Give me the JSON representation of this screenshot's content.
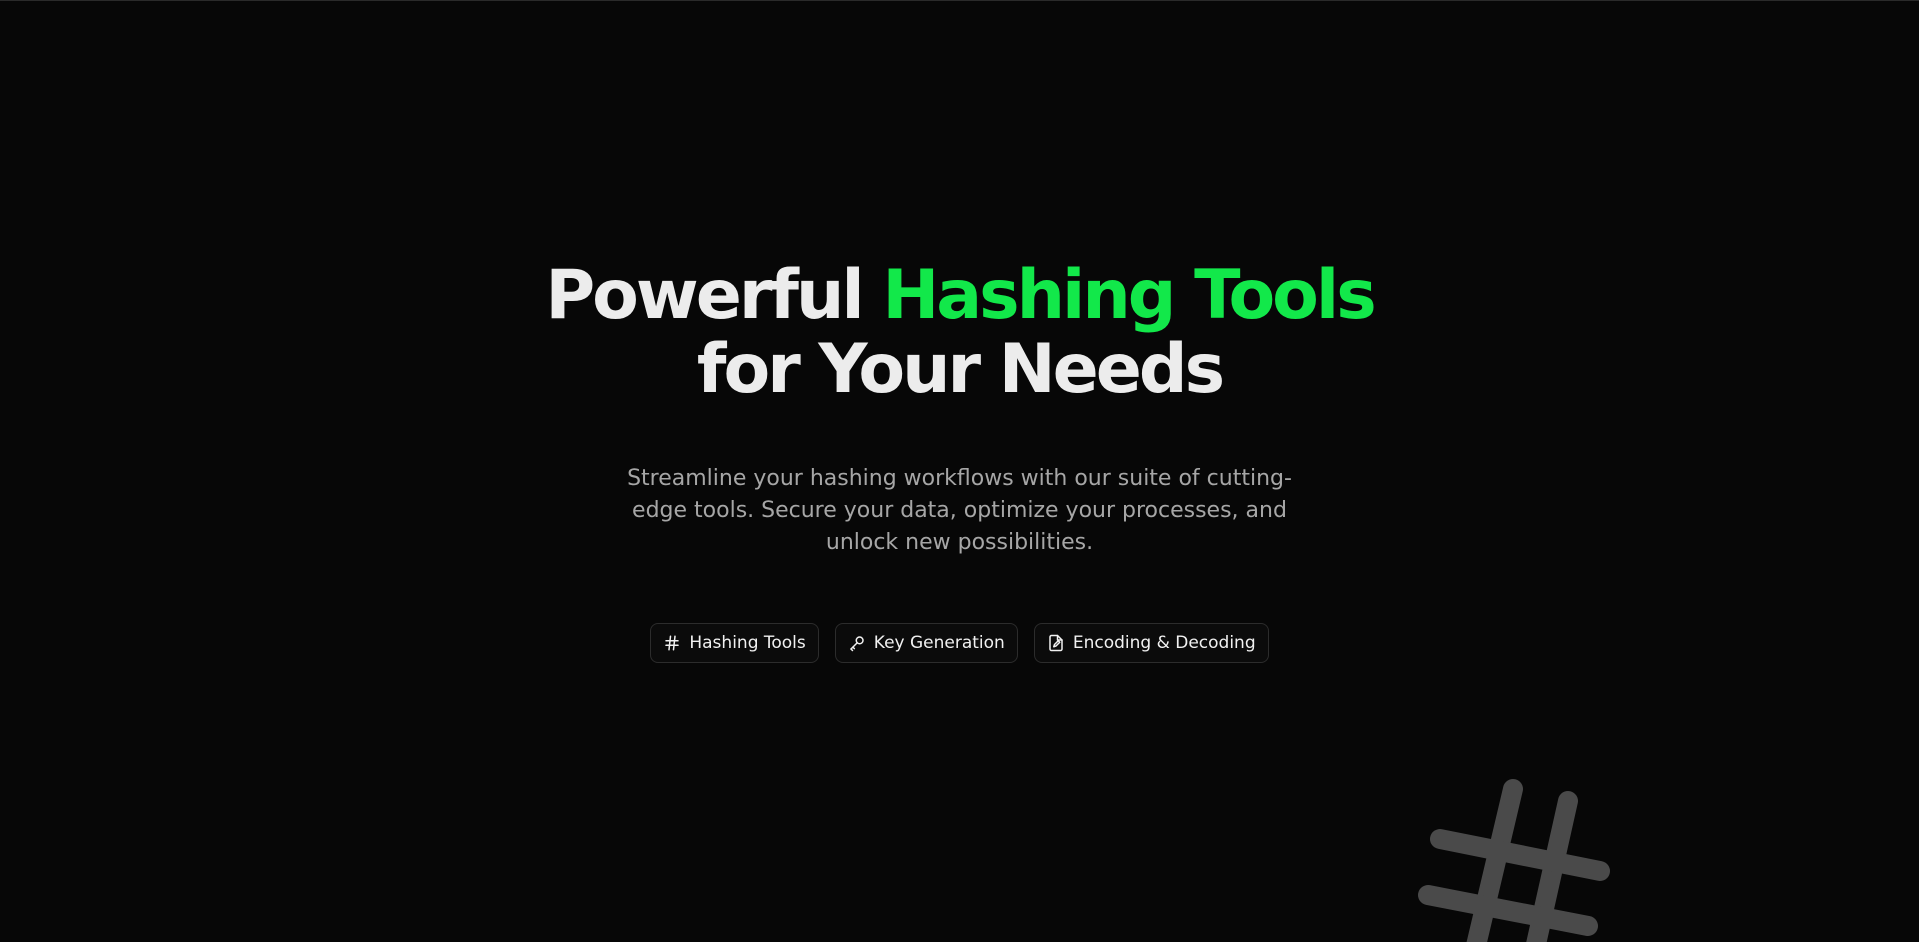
{
  "hero": {
    "headline_part1": "Powerful ",
    "headline_accent": "Hashing Tools",
    "headline_part2": "for Your Needs",
    "subtitle": "Streamline your hashing workflows with our suite of cutting-edge tools. Secure your data, optimize your processes, and unlock new possibilities."
  },
  "pills": [
    {
      "label": "Hashing Tools",
      "icon": "hash-icon"
    },
    {
      "label": "Key Generation",
      "icon": "key-icon"
    },
    {
      "label": "Encoding & Decoding",
      "icon": "file-edit-icon"
    }
  ],
  "decoration": {
    "icon": "hash-icon"
  },
  "colors": {
    "background": "#070707",
    "accent": "#12e84a",
    "headline": "#ececec",
    "subtitle": "#a6a6a6",
    "decoration": "#4a4a4a"
  }
}
